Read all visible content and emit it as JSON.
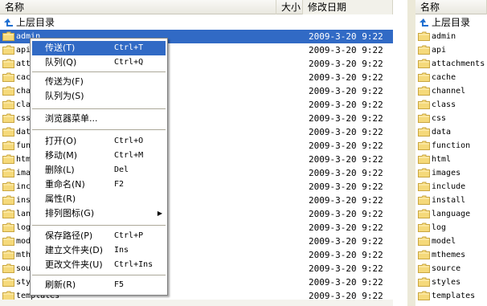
{
  "left_pane": {
    "columns": {
      "name": "名称",
      "size": "大小",
      "date": "修改日期"
    },
    "up_dir": "上层目录",
    "rows": [
      {
        "name": "admin",
        "date": "2009-3-20 9:22"
      },
      {
        "name": "api",
        "date": "2009-3-20 9:22"
      },
      {
        "name": "attachments",
        "date": "2009-3-20 9:22"
      },
      {
        "name": "cache",
        "date": "2009-3-20 9:22"
      },
      {
        "name": "channel",
        "date": "2009-3-20 9:22"
      },
      {
        "name": "class",
        "date": "2009-3-20 9:22"
      },
      {
        "name": "css",
        "date": "2009-3-20 9:22"
      },
      {
        "name": "data",
        "date": "2009-3-20 9:22"
      },
      {
        "name": "function",
        "date": "2009-3-20 9:22"
      },
      {
        "name": "html",
        "date": "2009-3-20 9:22"
      },
      {
        "name": "images",
        "date": "2009-3-20 9:22"
      },
      {
        "name": "include",
        "date": "2009-3-20 9:22"
      },
      {
        "name": "install",
        "date": "2009-3-20 9:22"
      },
      {
        "name": "language",
        "date": "2009-3-20 9:22"
      },
      {
        "name": "log",
        "date": "2009-3-20 9:22"
      },
      {
        "name": "model",
        "date": "2009-3-20 9:22"
      },
      {
        "name": "mthemes",
        "date": "2009-3-20 9:22"
      },
      {
        "name": "source",
        "date": "2009-3-20 9:22"
      },
      {
        "name": "styles",
        "date": "2009-3-20 9:22"
      },
      {
        "name": "templates",
        "date": "2009-3-20 9:22"
      }
    ]
  },
  "right_pane": {
    "columns": {
      "name": "名称"
    },
    "up_dir": "上层目录",
    "rows": [
      "admin",
      "api",
      "attachments",
      "cache",
      "channel",
      "class",
      "css",
      "data",
      "function",
      "html",
      "images",
      "include",
      "install",
      "language",
      "log",
      "model",
      "mthemes",
      "source",
      "styles",
      "templates"
    ]
  },
  "context_menu": {
    "items": [
      {
        "label": "传送(T)",
        "shortcut": "Ctrl+T"
      },
      {
        "label": "队列(Q)",
        "shortcut": "Ctrl+Q"
      },
      {
        "label": "传送为(F)",
        "shortcut": ""
      },
      {
        "label": "队列为(S)",
        "shortcut": ""
      },
      {
        "label": "浏览器菜单...",
        "shortcut": ""
      },
      {
        "label": "打开(O)",
        "shortcut": "Ctrl+O"
      },
      {
        "label": "移动(M)",
        "shortcut": "Ctrl+M"
      },
      {
        "label": "删除(L)",
        "shortcut": "Del"
      },
      {
        "label": "重命名(N)",
        "shortcut": "F2"
      },
      {
        "label": "属性(R)",
        "shortcut": ""
      },
      {
        "label": "排列图标(G)",
        "shortcut": ""
      },
      {
        "label": "保存路径(P)",
        "shortcut": "Ctrl+P"
      },
      {
        "label": "建立文件夹(D)",
        "shortcut": "Ins"
      },
      {
        "label": "更改文件夹(U)",
        "shortcut": "Ctrl+Ins"
      },
      {
        "label": "刷新(R)",
        "shortcut": "F5"
      }
    ]
  },
  "colors": {
    "selection": "#316ac5",
    "folder": "#f5d97a",
    "folder_edge": "#c9a640",
    "up_arrow": "#1f6fd1"
  },
  "icons": {
    "folder": "folder-icon",
    "up": "up-arrow-icon",
    "submenu": "submenu-arrow-icon"
  }
}
